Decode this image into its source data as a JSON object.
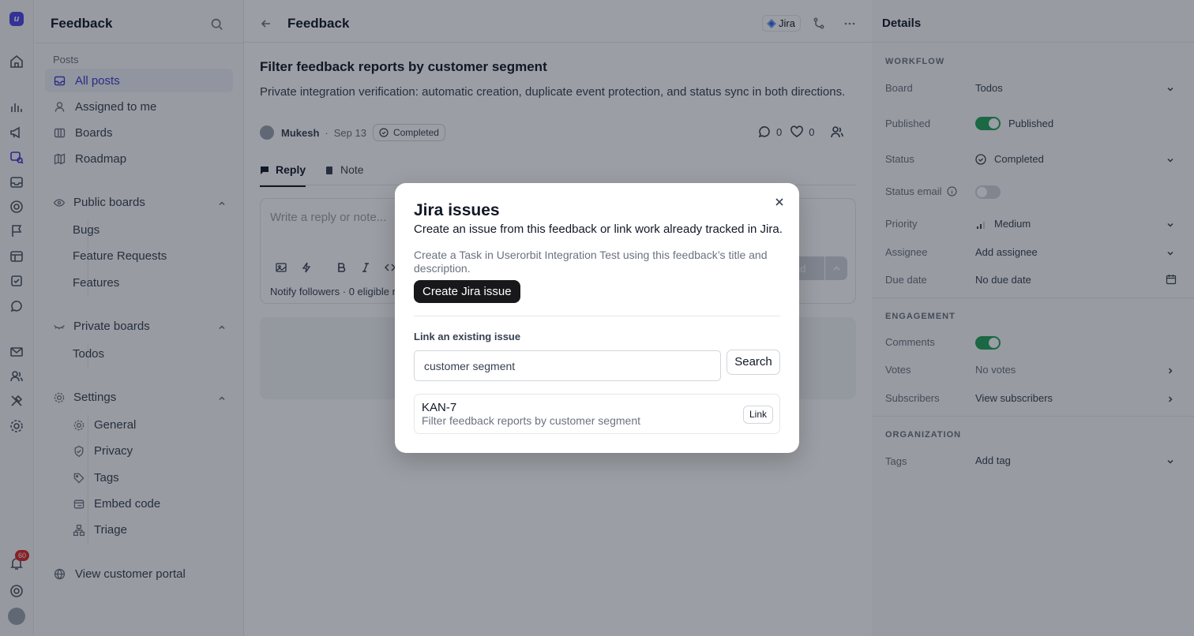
{
  "rail": {
    "logo_text": "u",
    "icons": [
      "home-icon",
      "chart-icon",
      "megaphone-icon",
      "feedback-search-icon",
      "inbox-icon",
      "help-icon",
      "flag-icon",
      "board-icon",
      "check-icon",
      "chat-icon",
      "mail-icon",
      "users-icon",
      "tools-icon",
      "settings-icon"
    ],
    "notification_count": "60"
  },
  "sidebar": {
    "title": "Feedback",
    "posts_label": "Posts",
    "items": [
      {
        "label": "All posts",
        "icon": "inbox-icon",
        "active": true
      },
      {
        "label": "Assigned to me",
        "icon": "user-icon"
      },
      {
        "label": "Boards",
        "icon": "boards-icon"
      },
      {
        "label": "Roadmap",
        "icon": "map-icon"
      }
    ],
    "public_boards": {
      "label": "Public boards",
      "items": [
        "Bugs",
        "Feature Requests",
        "Features"
      ]
    },
    "private_boards": {
      "label": "Private boards",
      "items": [
        "Todos"
      ]
    },
    "settings": {
      "label": "Settings",
      "items": [
        {
          "label": "General",
          "icon": "gear-icon"
        },
        {
          "label": "Privacy",
          "icon": "shield-icon"
        },
        {
          "label": "Tags",
          "icon": "tag-icon"
        },
        {
          "label": "Embed code",
          "icon": "embed-icon"
        },
        {
          "label": "Triage",
          "icon": "triage-icon"
        }
      ]
    },
    "portal_label": "View customer portal"
  },
  "main": {
    "title": "Feedback",
    "jira_chip": "Jira",
    "post": {
      "title": "Filter feedback reports by customer segment",
      "description": "Private integration verification: automatic creation, duplicate event protection, and status sync in both directions.",
      "author": "Mukesh",
      "date": "Sep 13",
      "status": "Completed",
      "comments": "0",
      "likes": "0"
    },
    "tabs": {
      "reply": "Reply",
      "note": "Note"
    },
    "editor": {
      "placeholder": "Write a reply or note...",
      "notify": "Notify followers · 0 eligible r",
      "send": "nd"
    }
  },
  "details": {
    "title": "Details",
    "workflow_label": "WORKFLOW",
    "board": {
      "label": "Board",
      "value": "Todos"
    },
    "published": {
      "label": "Published",
      "value": "Published"
    },
    "status": {
      "label": "Status",
      "value": "Completed"
    },
    "status_email": {
      "label": "Status email"
    },
    "priority": {
      "label": "Priority",
      "value": "Medium"
    },
    "assignee": {
      "label": "Assignee",
      "value": "Add assignee"
    },
    "due_date": {
      "label": "Due date",
      "value": "No due date"
    },
    "engagement_label": "ENGAGEMENT",
    "comments": {
      "label": "Comments"
    },
    "votes": {
      "label": "Votes",
      "value": "No votes"
    },
    "subscribers": {
      "label": "Subscribers",
      "value": "View subscribers"
    },
    "organization_label": "ORGANIZATION",
    "tags": {
      "label": "Tags",
      "value": "Add tag"
    }
  },
  "modal": {
    "title": "Jira issues",
    "subtitle": "Create an issue from this feedback or link work already tracked in Jira.",
    "create_description": "Create a Task in Userorbit Integration Test using this feedback’s title and description.",
    "create_button": "Create Jira issue",
    "link_label": "Link an existing issue",
    "search_value": "customer segment",
    "search_button": "Search",
    "result": {
      "key": "KAN-7",
      "title": "Filter feedback reports by customer segment",
      "link_button": "Link"
    }
  },
  "colors": {
    "accent": "#4338ca",
    "toggle_on": "#22a35a",
    "primary_button": "#18181b"
  }
}
